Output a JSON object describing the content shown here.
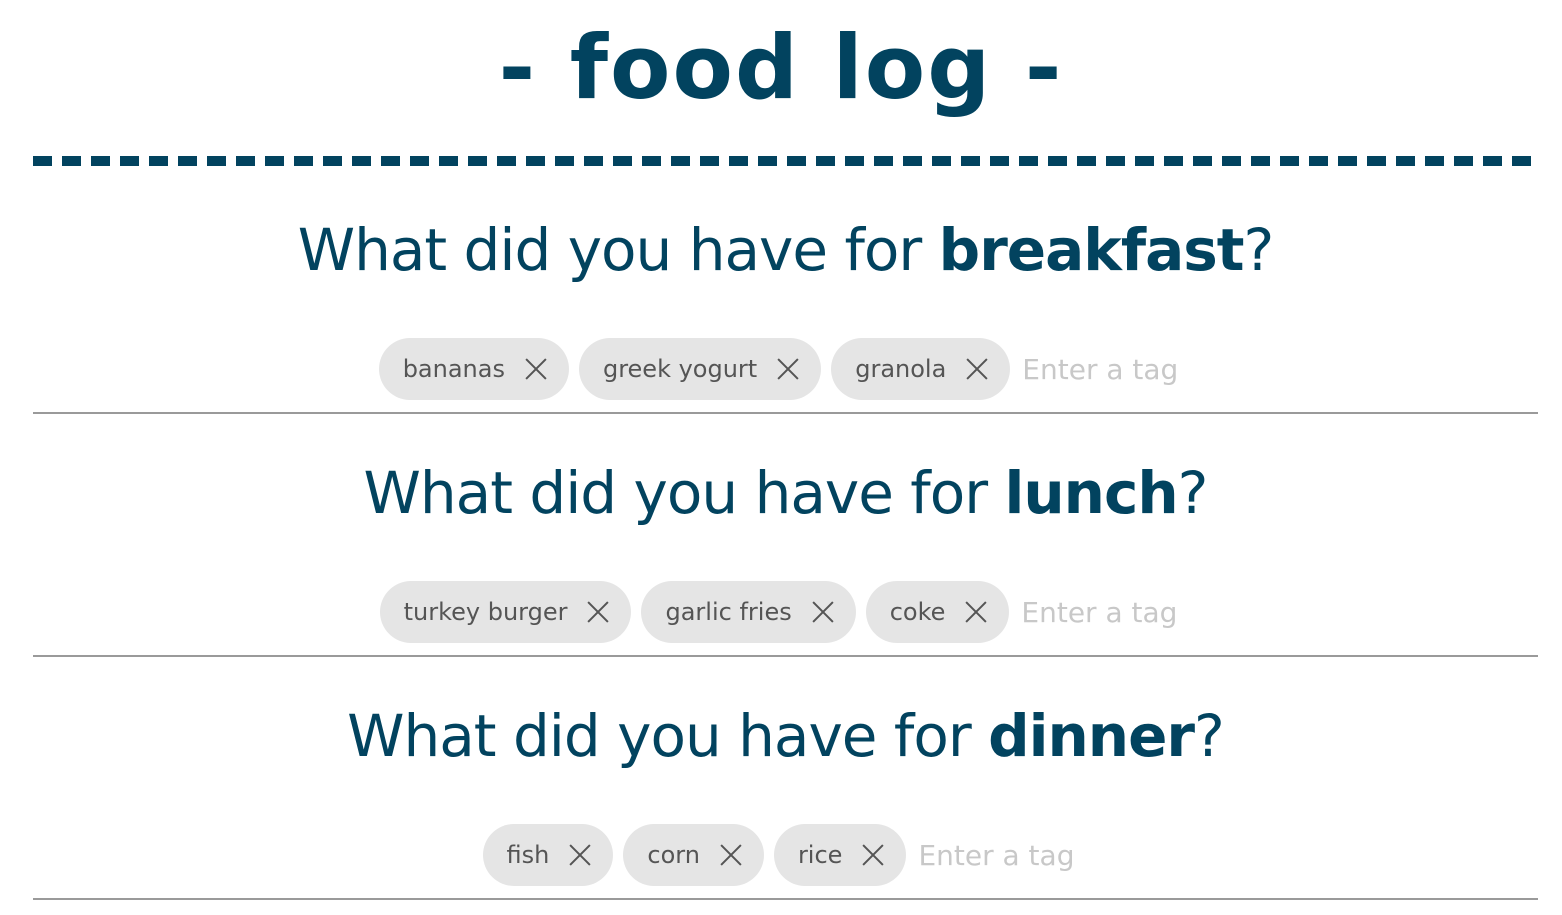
{
  "app": {
    "title": "- food log -"
  },
  "meals": [
    {
      "prefix": "What did you have for ",
      "meal": "breakfast",
      "suffix": "?",
      "tags": [
        "bananas",
        "greek yogurt",
        "granola"
      ],
      "placeholder": "Enter a tag"
    },
    {
      "prefix": "What did you have for ",
      "meal": "lunch",
      "suffix": "?",
      "tags": [
        "turkey burger",
        "garlic fries",
        "coke"
      ],
      "placeholder": "Enter a tag"
    },
    {
      "prefix": "What did you have for ",
      "meal": "dinner",
      "suffix": "?",
      "tags": [
        "fish",
        "corn",
        "rice"
      ],
      "placeholder": "Enter a tag"
    }
  ],
  "icons": {
    "remove_tag": "close-icon"
  },
  "colors": {
    "primary": "#02435f",
    "tag_bg": "#e5e5e5",
    "tag_text": "#555555",
    "placeholder": "#c8c8c8",
    "divider": "#9a9a9a"
  }
}
